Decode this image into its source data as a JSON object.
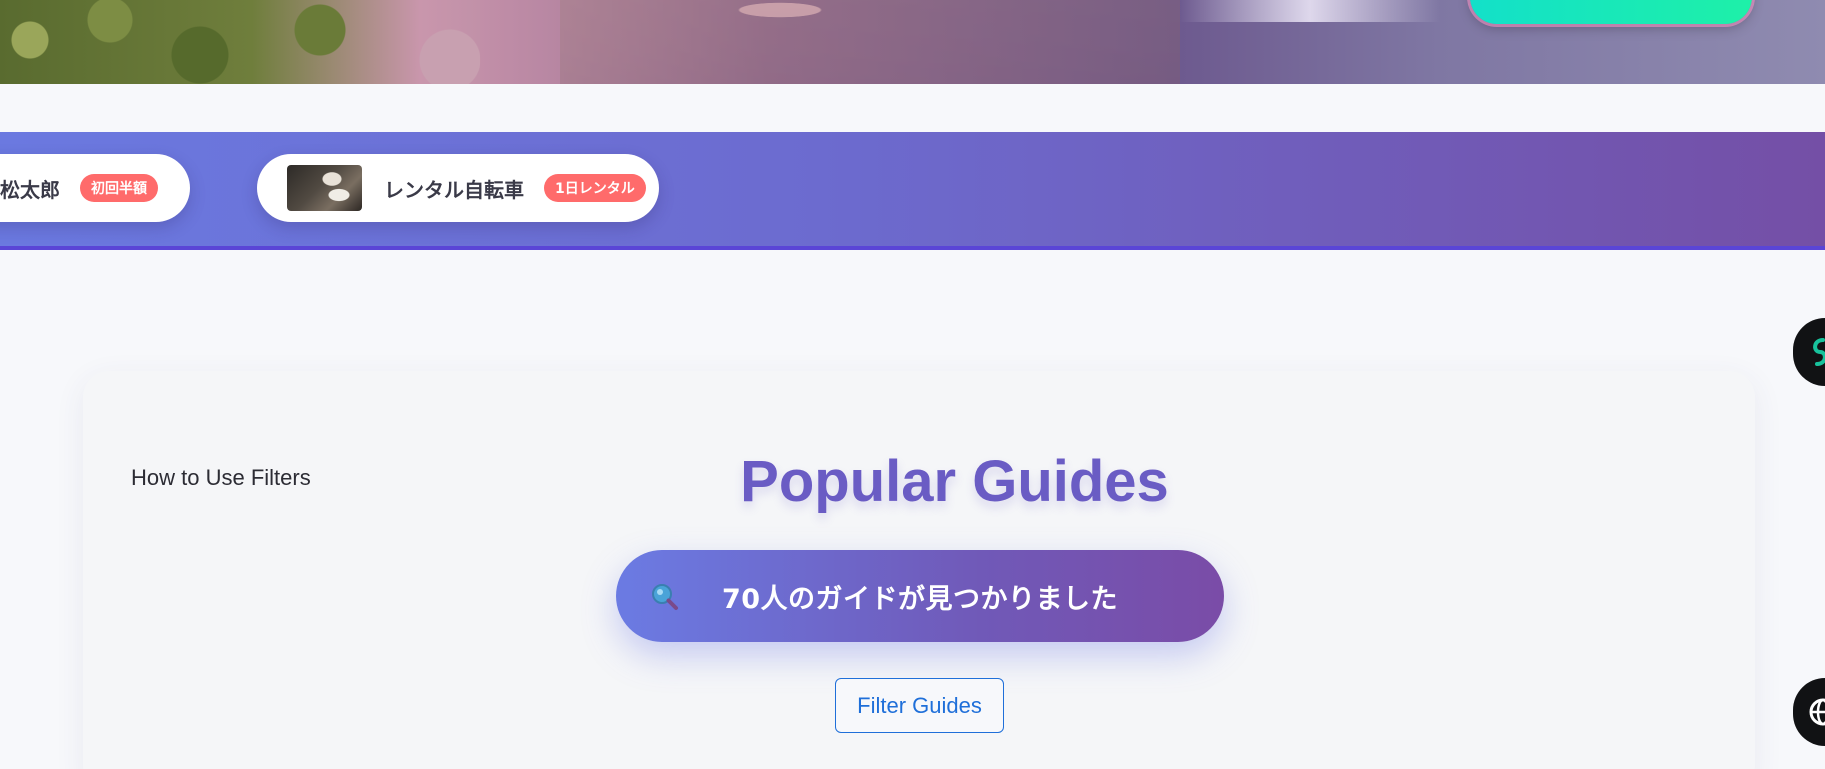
{
  "hero": {
    "cta_color": "#16e8b8"
  },
  "promo": {
    "items": [
      {
        "name": "松太郎",
        "tag": "初回半額"
      },
      {
        "name": "レンタル自転車",
        "tag": "1日レンタル",
        "thumb": "bicycle-photo"
      }
    ],
    "tag_color": "#ff6b6b"
  },
  "filters": {
    "how_to_label": "How to Use Filters",
    "title": "Popular Guides",
    "results_text": "70人のガイドが見つかりました",
    "results_icon": "search-icon",
    "filter_button_label": "Filter Guides"
  },
  "side_widgets": {
    "top_icon": "link-icon",
    "bottom_icon": "globe-icon"
  },
  "colors": {
    "accent": "#6a5cc4",
    "band_start": "#6b79e0",
    "band_end": "#744fa6",
    "link": "#1f6fd9"
  }
}
